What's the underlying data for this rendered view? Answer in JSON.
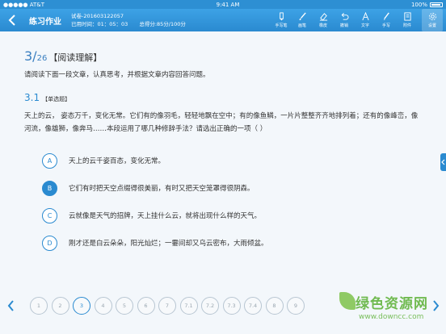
{
  "status_bar": {
    "carrier": "●●●●● AT&T",
    "time": "9:41 AM",
    "battery": "100%"
  },
  "header": {
    "title": "练习作业",
    "paper_label": "试卷-201603122057",
    "time_label": "已用时间：01：05：03",
    "score_label": "总得分:85分/100分"
  },
  "tools": [
    {
      "label": "手写笔",
      "icon": "pen-icon"
    },
    {
      "label": "画笔",
      "icon": "brush-icon"
    },
    {
      "label": "橡皮",
      "icon": "eraser-icon"
    },
    {
      "label": "撤销",
      "icon": "undo-icon"
    },
    {
      "label": "文字",
      "icon": "text-icon"
    },
    {
      "label": "手写",
      "icon": "handwrite-icon"
    },
    {
      "label": "附件",
      "icon": "attachment-icon"
    },
    {
      "label": "设置",
      "icon": "gear-icon"
    }
  ],
  "question": {
    "number": "3/",
    "total": "26",
    "section": "【阅读理解】",
    "instruction": "请阅读下面一段文章，认真思考，并根据文章内容回答问题。",
    "sub_number": "3.1",
    "sub_type": "【单选题】",
    "stem": "天上的云，  姿态万千，变化无常。它们有的像羽毛，轻轻地飘在空中；有的像鱼鳞，一片片整整齐齐地排列着；还有的像峰峦，像河流，像雄狮，像奔马……本段运用了哪几种修辞手法？请选出正确的一项（      ）"
  },
  "options": [
    {
      "letter": "A",
      "text": "天上的云千姿百态，变化无常。",
      "selected": false
    },
    {
      "letter": "B",
      "text": "它们有时把天空点缀得很美丽，有时又把天空笼罩得很阴森。",
      "selected": true
    },
    {
      "letter": "C",
      "text": "云就像是天气的招牌，天上挂什么云，就将出现什么样的天气。",
      "selected": false
    },
    {
      "letter": "D",
      "text": "刚才还是白云朵朵，阳光灿烂；一霎间却又乌云密布，大雨倾盆。",
      "selected": false
    }
  ],
  "pagination": {
    "pages": [
      "1",
      "2",
      "3",
      "4",
      "5",
      "6",
      "7",
      "7.1",
      "7.2",
      "7.3",
      "7.4",
      "8",
      "9"
    ],
    "current": "3"
  },
  "watermark": {
    "text": "绿色资源网",
    "sub": "www.downcc.com"
  },
  "colors": {
    "primary": "#2a8ad0",
    "watermark": "#5ab033"
  }
}
